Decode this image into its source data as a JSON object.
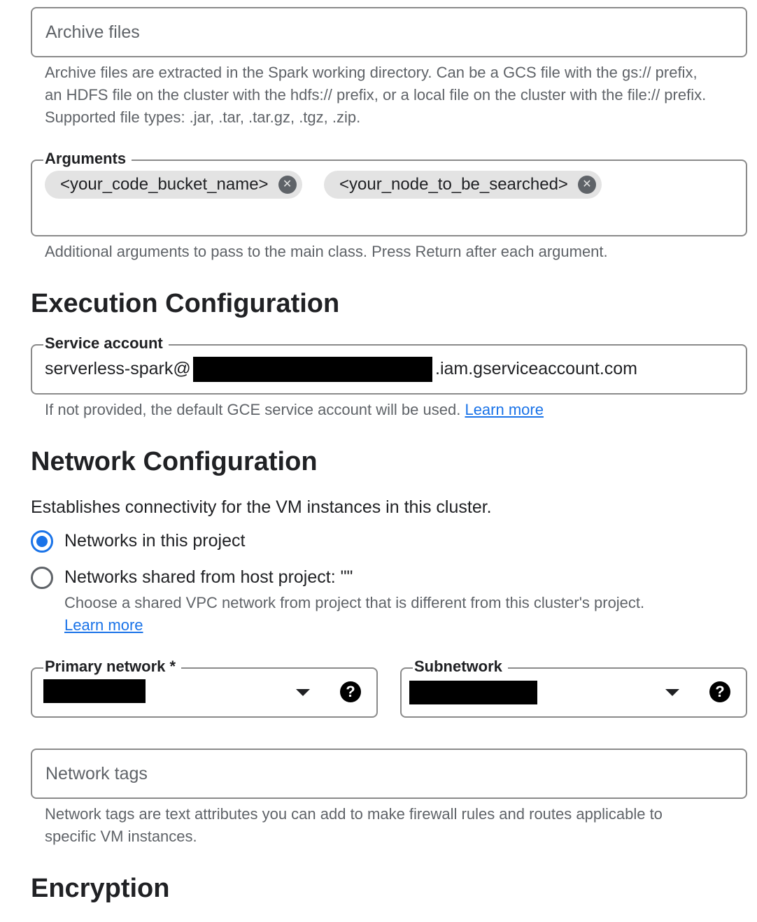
{
  "archive_files": {
    "placeholder": "Archive files",
    "help": "Archive files are extracted in the Spark working directory. Can be a GCS file with the gs:// prefix, an HDFS file on the cluster with the hdfs:// prefix, or a local file on the cluster with the file:// prefix. Supported file types: .jar, .tar, .tar.gz, .tgz, .zip."
  },
  "arguments": {
    "label": "Arguments",
    "chips": [
      "<your_code_bucket_name>",
      "<your_node_to_be_searched>"
    ],
    "help": "Additional arguments to pass to the main class. Press Return after each argument."
  },
  "execution": {
    "heading": "Execution Configuration",
    "service_account": {
      "label": "Service account",
      "value_prefix": "serverless-spark@",
      "value_suffix": ".iam.gserviceaccount.com",
      "help": "If not provided, the default GCE service account will be used.",
      "learn_more": "Learn more"
    }
  },
  "network": {
    "heading": "Network Configuration",
    "description": "Establishes connectivity for the VM instances in this cluster.",
    "options": [
      {
        "label": "Networks in this project",
        "selected": true
      },
      {
        "label": "Networks shared from host project: \"\"",
        "selected": false
      }
    ],
    "shared_help": "Choose a shared VPC network from project that is different from this cluster's project.",
    "learn_more": "Learn more",
    "primary_network": {
      "label": "Primary network *",
      "help_icon": "?"
    },
    "subnetwork": {
      "label": "Subnetwork",
      "help_icon": "?"
    },
    "tags": {
      "placeholder": "Network tags",
      "help": "Network tags are text attributes you can add to make firewall rules and routes applicable to specific VM instances."
    }
  },
  "encryption": {
    "heading": "Encryption"
  },
  "colors": {
    "accent": "#1a73e8",
    "border": "#8a8a8a",
    "chip": "#e3e3e3"
  }
}
